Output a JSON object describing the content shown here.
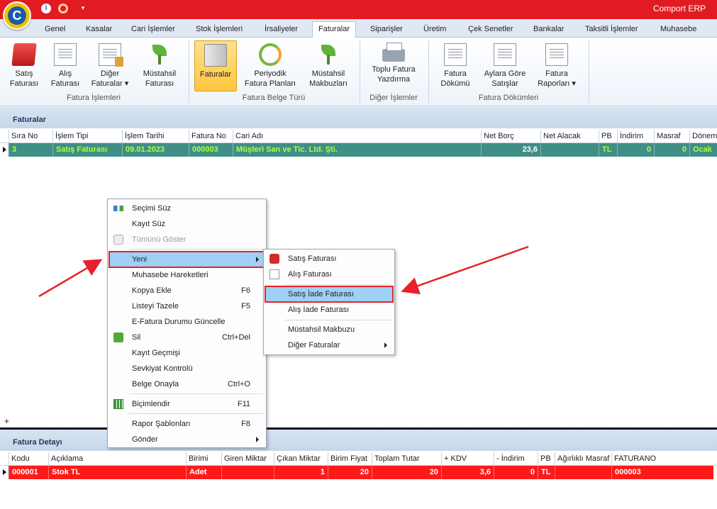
{
  "colors": {
    "titlebar": "#e21b23",
    "green_row_bg": "#3f8f86",
    "green_row_text": "#b4ff36",
    "red_row_bg": "#ff1a1a",
    "highlight": "#9fd0f5",
    "annotation_red": "#e8202a"
  },
  "app": {
    "title": "Comport ERP",
    "logo_letter": "C"
  },
  "tabs": [
    {
      "label": "Genel"
    },
    {
      "label": "Kasalar"
    },
    {
      "label": "Cari İşlemler"
    },
    {
      "label": "Stok İşlemleri"
    },
    {
      "label": "İrsaliyeler"
    },
    {
      "label": "Faturalar",
      "active": true
    },
    {
      "label": "Siparişler"
    },
    {
      "label": "Üretim"
    },
    {
      "label": "Çek Senetler"
    },
    {
      "label": "Bankalar"
    },
    {
      "label": "Taksitli İşlemler"
    },
    {
      "label": "Muhasebe"
    }
  ],
  "ribbon": {
    "groups": [
      {
        "label": "Fatura İşlemleri"
      },
      {
        "label": "Fatura Belge Türü"
      },
      {
        "label": "Diğer İşlemler"
      },
      {
        "label": "Fatura Dökümleri"
      }
    ],
    "buttons": [
      {
        "line1": "Satış",
        "line2": "Faturası",
        "icon": "red-folder-icon"
      },
      {
        "line1": "Alış",
        "line2": "Faturası",
        "icon": "document-icon"
      },
      {
        "line1": "Diğer",
        "line2": "Faturalar ▾",
        "icon": "chart-document-icon"
      },
      {
        "line1": "Müstahsil",
        "line2": "Faturası",
        "icon": "plant-icon"
      },
      {
        "line1": "Faturalar",
        "line2": "",
        "icon": "book-icon"
      },
      {
        "line1": "Periyodik",
        "line2": "Fatura Planları",
        "icon": "refresh-icon"
      },
      {
        "line1": "Müstahsil",
        "line2": "Makbuzları",
        "icon": "plant-icon"
      },
      {
        "line1": "Toplu Fatura",
        "line2": "Yazdırma",
        "icon": "printer-icon"
      },
      {
        "line1": "Fatura",
        "line2": "Dökümü",
        "icon": "document-icon"
      },
      {
        "line1": "Aylara Göre",
        "line2": "Satışlar",
        "icon": "document-icon"
      },
      {
        "line1": "Fatura",
        "line2": "Raporları ▾",
        "icon": "documents-icon"
      }
    ]
  },
  "faturalar": {
    "title": "Faturalar",
    "columns": [
      "Sıra No",
      "İşlem Tipi",
      "İşlem Tarihi",
      "Fatura No",
      "Cari Adı",
      "Net Borç",
      "Net Alacak",
      "PB",
      "İndirim",
      "Masraf",
      "Dönem"
    ],
    "rows": [
      [
        "3",
        "Satış Faturası",
        "09.01.2023",
        "000003",
        "Müşteri San ve Tic. Ltd. Şti.",
        "23,6",
        "",
        "TL",
        "0",
        "0",
        "Ocak"
      ]
    ],
    "new_row_symbol": "+"
  },
  "detay": {
    "title": "Fatura Detayı",
    "columns": [
      "Kodu",
      "Açıklama",
      "Birimi",
      "Giren Miktar",
      "Çıkan Miktar",
      "Birim Fiyat",
      "Toplam Tutar",
      "+ KDV",
      "- İndirim",
      "PB",
      "Ağırlıklı Masraf",
      "FATURANO"
    ],
    "rows": [
      [
        "000001",
        "Stok TL",
        "Adet",
        "",
        "1",
        "20",
        "20",
        "3,6",
        "0",
        "TL",
        "",
        "000003"
      ]
    ]
  },
  "context_menu": {
    "items": [
      {
        "label": "Seçimi Süz",
        "shortcut": "",
        "icon": "filter-icon"
      },
      {
        "label": "Kayıt Süz",
        "shortcut": ""
      },
      {
        "label": "Tümünü Göster",
        "shortcut": "",
        "icon": "eraser-icon",
        "disabled": true
      },
      {
        "label": "Yeni",
        "shortcut": "",
        "submenu": true,
        "highlighted": true
      },
      {
        "label": "Muhasebe Hareketleri",
        "shortcut": ""
      },
      {
        "label": "Kopya Ekle",
        "shortcut": "F6"
      },
      {
        "label": "Listeyi Tazele",
        "shortcut": "F5"
      },
      {
        "label": "E-Fatura Durumu Güncelle",
        "shortcut": ""
      },
      {
        "label": "Sil",
        "shortcut": "Ctrl+Del",
        "icon": "trash-icon"
      },
      {
        "label": "Kayıt Geçmişi",
        "shortcut": ""
      },
      {
        "label": "Sevkiyat Kontrolü",
        "shortcut": ""
      },
      {
        "label": "Belge Onayla",
        "shortcut": "Ctrl+O"
      },
      {
        "label": "Biçimlendir",
        "shortcut": "F11",
        "icon": "grid-icon"
      },
      {
        "label": "Rapor Şablonları",
        "shortcut": "F8"
      },
      {
        "label": "Gönder",
        "shortcut": "",
        "submenu": true
      }
    ]
  },
  "submenu": {
    "items": [
      {
        "label": "Satış Faturası",
        "icon": "red-bag-icon"
      },
      {
        "label": "Alış Faturası",
        "icon": "page-icon"
      },
      {
        "label": "Satış İade Faturası",
        "highlighted": true
      },
      {
        "label": "Alış İade Faturası"
      },
      {
        "label": "Müstahsil Makbuzu"
      },
      {
        "label": "Diğer Faturalar",
        "submenu": true
      }
    ]
  }
}
